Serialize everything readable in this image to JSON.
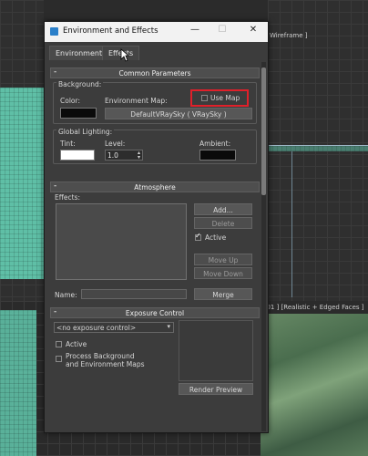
{
  "viewport_top": {
    "label": "Wireframe ]"
  },
  "viewport_bottom": {
    "label": "001 ] [Realistic + Edged Faces ]"
  },
  "dialog": {
    "title": "Environment and Effects",
    "controls": {
      "minimize": "—",
      "maximize": "☐",
      "close": "✕"
    },
    "tabs": [
      {
        "label": "Environment",
        "active": true
      },
      {
        "label": "Effects",
        "active": false
      }
    ]
  },
  "common": {
    "header": "Common Parameters",
    "collapse": "-",
    "background_group": "Background:",
    "color_label": "Color:",
    "color_value": "#0a0a0a",
    "env_map_label": "Environment Map:",
    "use_map_label": "Use Map",
    "use_map_checked": false,
    "map_button": "DefaultVRaySky  ( VRaySky )",
    "lighting_group": "Global Lighting:",
    "tint_label": "Tint:",
    "tint_value": "#ffffff",
    "level_label": "Level:",
    "level_value": "1.0",
    "ambient_label": "Ambient:",
    "ambient_value": "#0a0a0a"
  },
  "atmosphere": {
    "header": "Atmosphere",
    "collapse": "-",
    "effects_label": "Effects:",
    "add": "Add...",
    "delete": "Delete",
    "active_label": "Active",
    "active_checked": true,
    "move_up": "Move Up",
    "move_down": "Move Down",
    "name_label": "Name:",
    "name_value": "",
    "merge": "Merge"
  },
  "exposure": {
    "header": "Exposure Control",
    "collapse": "-",
    "dropdown_value": "<no exposure control>",
    "active_label": "Active",
    "process_bg_label_1": "Process Background",
    "process_bg_label_2": "and Environment Maps",
    "render_preview": "Render Preview"
  },
  "colors": {
    "highlight": "#e0202a",
    "viewport_teal": "#5fbfa6"
  }
}
